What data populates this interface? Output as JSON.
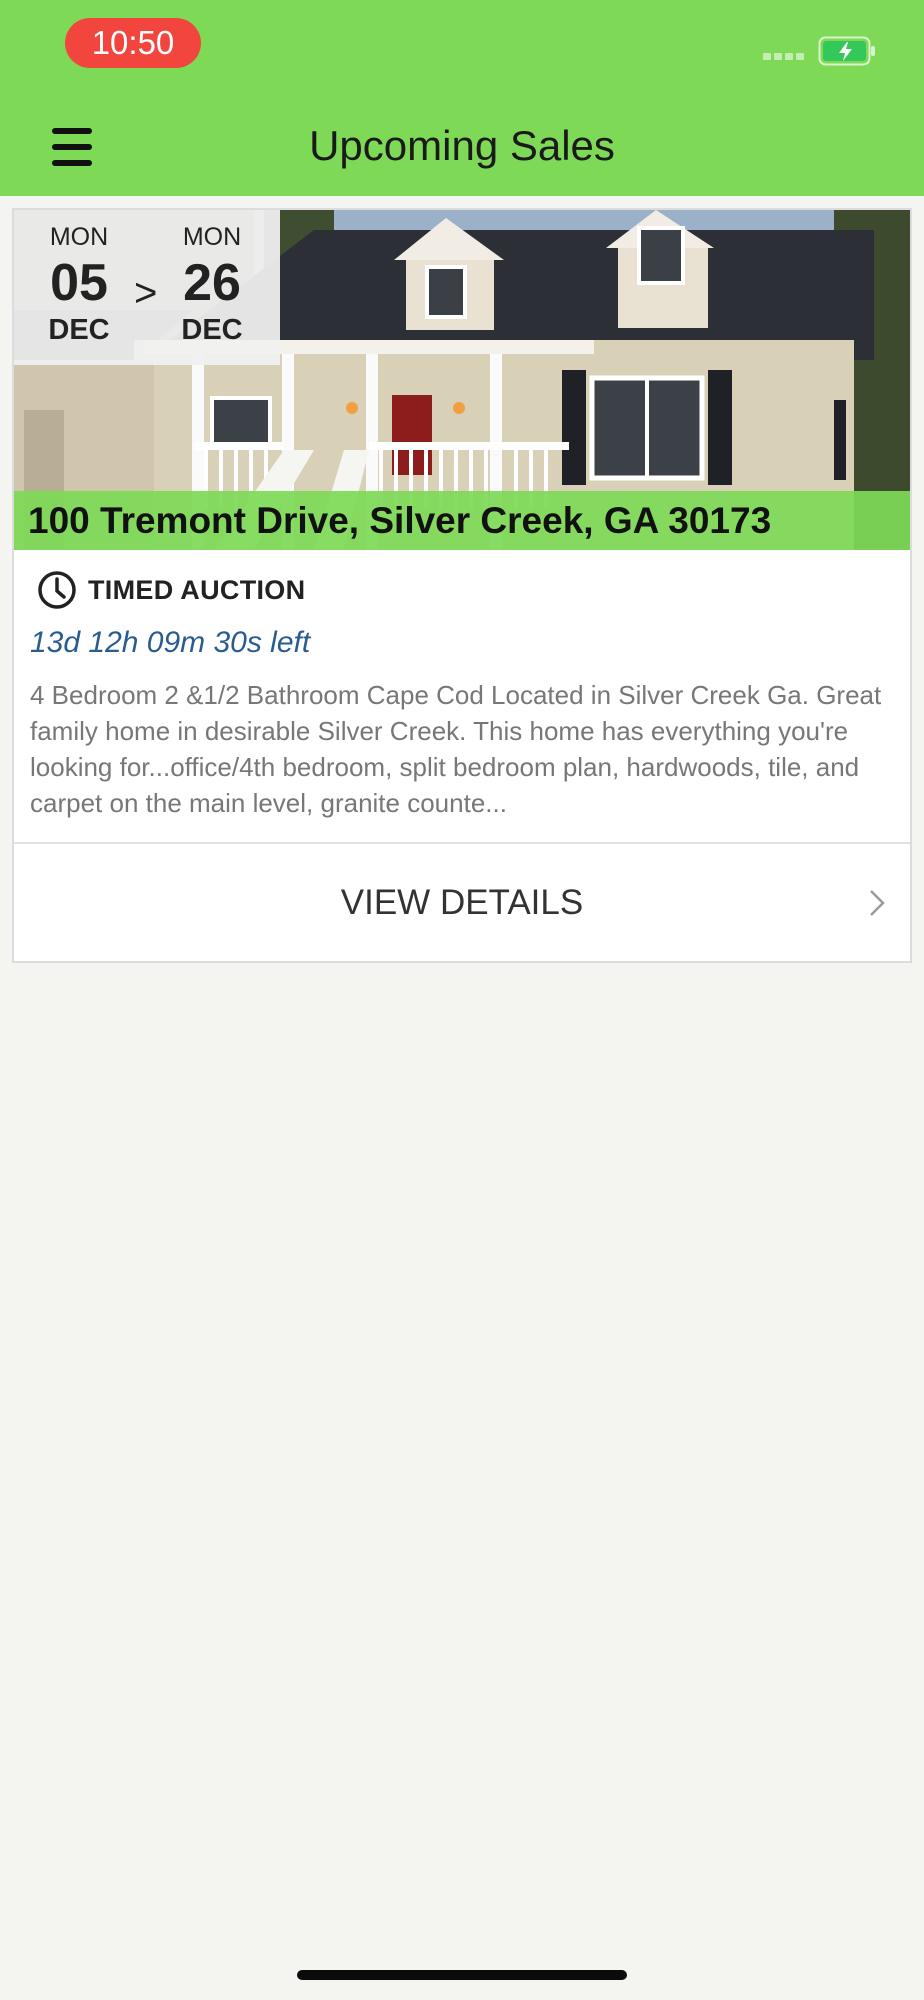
{
  "status_bar": {
    "time": "10:50"
  },
  "header": {
    "title": "Upcoming Sales",
    "background_color": "#7ed957"
  },
  "icons": {
    "menu": "hamburger-icon",
    "clock": "clock-icon",
    "chevron": "chevron-right-icon",
    "battery": "battery-charging-icon"
  },
  "listing": {
    "start": {
      "dow": "MON",
      "day": "05",
      "month": "DEC"
    },
    "separator": ">",
    "end": {
      "dow": "MON",
      "day": "26",
      "month": "DEC"
    },
    "address": "100 Tremont Drive, Silver Creek, GA 30173",
    "auction_type": "TIMED AUCTION",
    "time_left": "13d 12h 09m 30s left",
    "description": "4 Bedroom 2 &1/2 Bathroom Cape Cod Located in Silver Creek Ga. Great family home in desirable Silver Creek. This home has everything you're looking for...office/4th bedroom, split bedroom plan, hardwoods, tile, and carpet on the main level, granite counte...",
    "view_details_label": "VIEW DETAILS"
  },
  "colors": {
    "accent_green": "#7ed957",
    "time_badge": "#f2453d",
    "time_left_text": "#2a5c8f"
  }
}
